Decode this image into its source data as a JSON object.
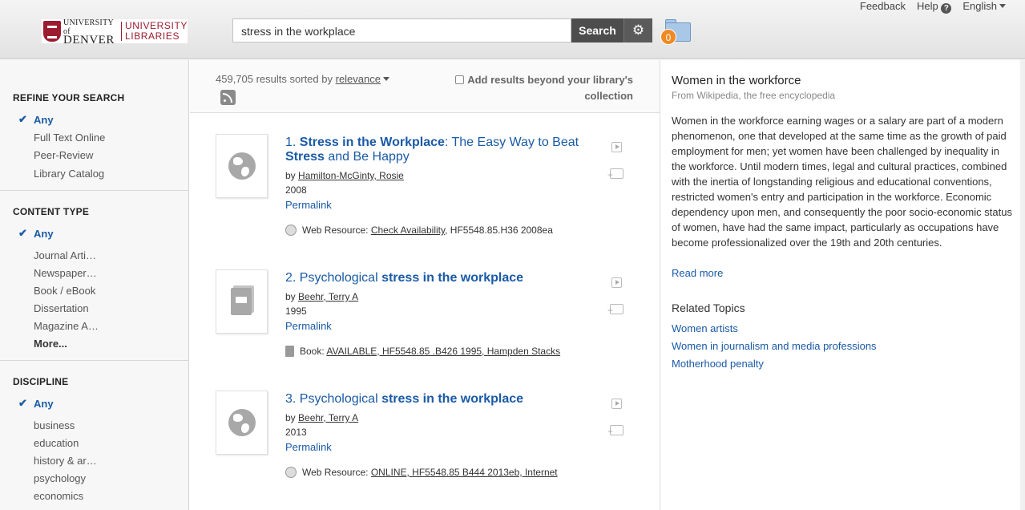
{
  "header": {
    "logo": {
      "line1": "UNIVERSITY of",
      "line2": "DENVER",
      "line3": "UNIVERSITY",
      "line4": "LIBRARIES"
    },
    "search_value": "stress in the workplace",
    "search_label": "Search",
    "settings_glyph": "⚙",
    "folder_count": "0",
    "nav": {
      "feedback": "Feedback",
      "help": "Help",
      "help_glyph": "?",
      "language": "English"
    }
  },
  "sidebar": {
    "refine": {
      "title": "REFINE YOUR SEARCH",
      "items": [
        "Any",
        "Full Text Online",
        "Peer-Review",
        "Library Catalog"
      ]
    },
    "content_type": {
      "title": "CONTENT TYPE",
      "items": [
        "Any",
        "Journal Arti…",
        "Newspaper…",
        "Book / eBook",
        "Dissertation",
        "Magazine A…",
        "More..."
      ]
    },
    "discipline": {
      "title": "DISCIPLINE",
      "items": [
        "Any",
        "business",
        "education",
        "history & ar…",
        "psychology",
        "economics"
      ]
    },
    "check_glyph": "✔"
  },
  "results": {
    "count": "459,705 results sorted by",
    "sort": "relevance",
    "beyond_1": "Add results beyond your library's",
    "beyond_2": "collection",
    "items": [
      {
        "num": "1.",
        "title_parts": [
          "Stress in the Workplace",
          ": The Easy Way to Beat ",
          "Stress",
          " and Be Happy"
        ],
        "by": "by",
        "author": "Hamilton-McGinty, Rosie",
        "year": "2008",
        "permalink": "Permalink",
        "avail_type": "Web Resource:",
        "avail_link": "Check Availability",
        "avail_rest": ", HF5548.85.H36 2008ea"
      },
      {
        "num": "2.",
        "title_parts": [
          "Psychological ",
          "stress in the workplace"
        ],
        "by": "by",
        "author": "Beehr, Terry A",
        "year": "1995",
        "permalink": "Permalink",
        "avail_type": "Book:",
        "avail_link": "AVAILABLE, HF5548.85 .B426 1995, Hampden Stacks",
        "avail_rest": ""
      },
      {
        "num": "3.",
        "title_parts": [
          "Psychological ",
          "stress in the workplace"
        ],
        "by": "by",
        "author": "Beehr, Terry A",
        "year": "2013",
        "permalink": "Permalink",
        "avail_type": "Web Resource:",
        "avail_link": "ONLINE, HF5548.85 B444 2013eb, Internet",
        "avail_rest": ""
      }
    ]
  },
  "wiki": {
    "title": "Women in the workforce",
    "source": "From Wikipedia, the free encyclopedia",
    "body": "Women in the workforce earning wages or a salary are part of a modern phenomenon, one that developed at the same time as the growth of paid employment for men; yet women have been challenged by inequality in the workforce. Until modern times, legal and cultural practices, combined with the inertia of longstanding religious and educational conventions, restricted women's entry and participation in the workforce. Economic dependency upon men, and consequently the poor socio-economic status of women, have had the same impact, particularly as occupations have become professionalized over the 19th and 20th centuries.",
    "read_more": "Read more",
    "related_title": "Related Topics",
    "related": [
      "Women artists",
      "Women in journalism and media professions",
      "Motherhood penalty"
    ]
  }
}
